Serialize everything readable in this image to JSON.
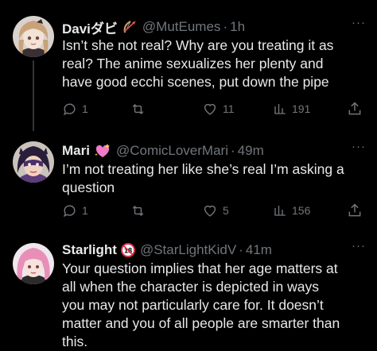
{
  "tweets": [
    {
      "name": "Daviダビ",
      "badge_icon": "bow-and-arrow-emoji",
      "handle": "@MutEumes",
      "separator": "·",
      "time": "1h",
      "more": "···",
      "text": "Isn’t she not real? Why are you treating it as\nreal? The anime sexualizes her plenty and\nhave good ecchi scenes, put down the pipe",
      "replies": "1",
      "retweets": "",
      "likes": "11",
      "views": "191"
    },
    {
      "name": "Mari",
      "badge_icon": "sparkling-heart-emoji",
      "handle": "@ComicLoverMari",
      "separator": "·",
      "time": "49m",
      "more": "···",
      "text": "I’m not treating her like she’s real I’m asking a\nquestion",
      "replies": "1",
      "retweets": "",
      "likes": "5",
      "views": "156"
    },
    {
      "name": "Starlight",
      "badge_icon": "no-one-under-eighteen-emoji",
      "handle": "@StarLightKidV",
      "separator": "·",
      "time": "41m",
      "more": "···",
      "text": "Your question implies that her age matters at\nall when the character is depicted in ways\nyou may not particularly care for. It doesn’t\nmatter and you of all people are smarter than\nthis."
    }
  ],
  "colors": {
    "background": "#000000",
    "text": "#e7e9ea",
    "muted": "#71767b",
    "thread_line": "#333639"
  }
}
